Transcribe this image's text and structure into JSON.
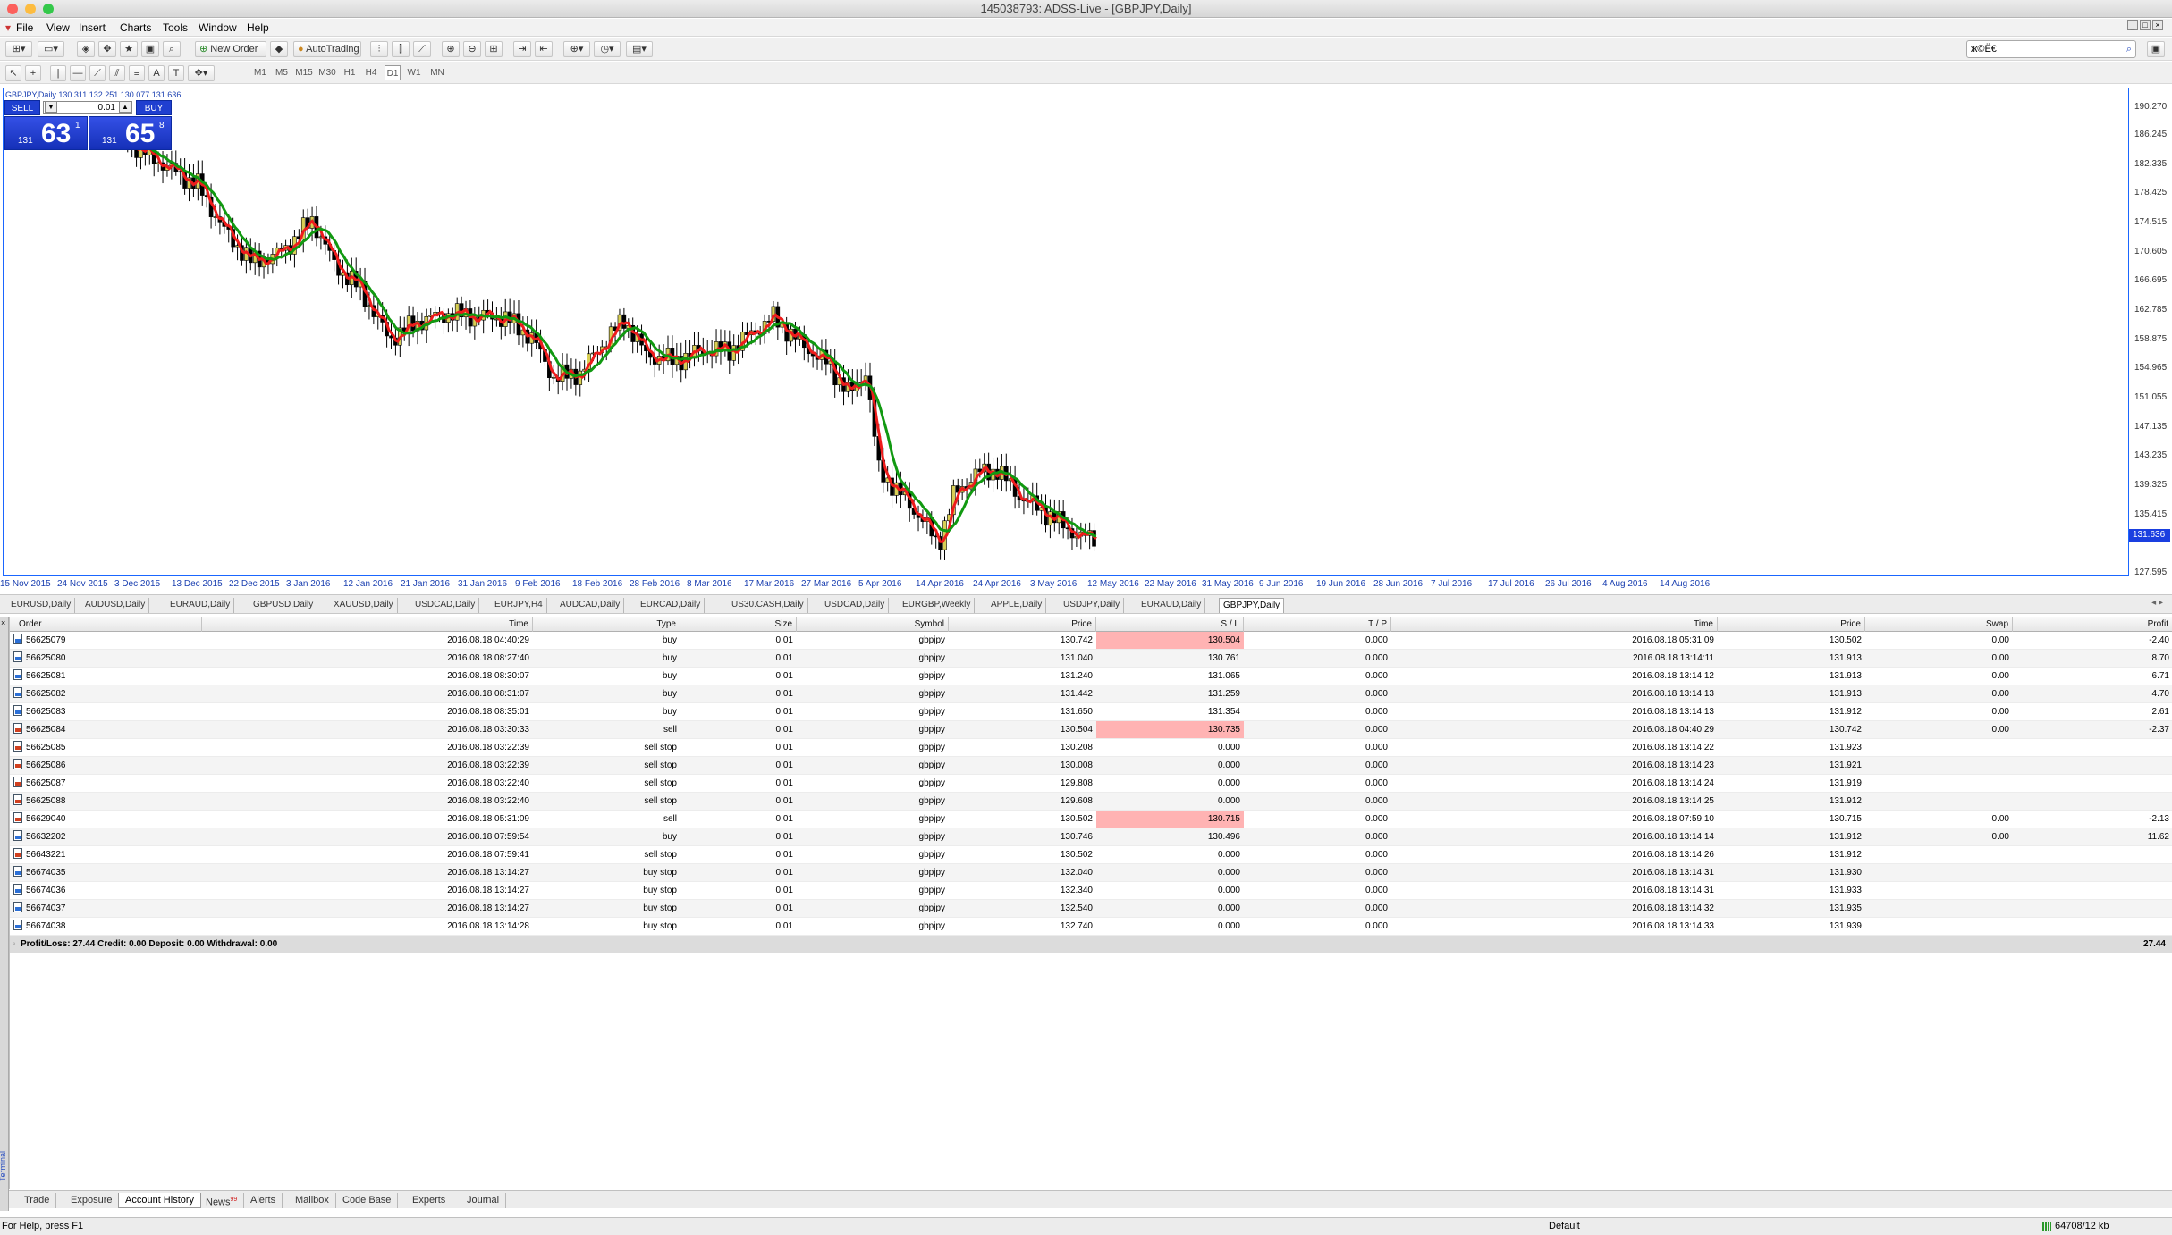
{
  "window": {
    "title": "145038793: ADSS-Live - [GBPJPY,Daily]"
  },
  "menu": [
    "File",
    "View",
    "Insert",
    "Charts",
    "Tools",
    "Window",
    "Help"
  ],
  "toolbar": {
    "new_order": "New Order",
    "autotrading": "AutoTrading",
    "search_value": "ж©Ё€",
    "timeframes": [
      "M1",
      "M5",
      "M15",
      "M30",
      "H1",
      "H4",
      "D1",
      "W1",
      "MN"
    ]
  },
  "chart": {
    "label": "GBPJPY,Daily  130.311 132.251 130.077 131.636",
    "one_click": {
      "sell_label": "SELL",
      "buy_label": "BUY",
      "lot": "0.01",
      "sell_small": "131",
      "sell_big": "63",
      "sell_sup": "1",
      "buy_small": "131",
      "buy_big": "65",
      "buy_sup": "8"
    },
    "current_price": "131.636",
    "price_ticks": [
      "190.270",
      "186.245",
      "182.335",
      "178.425",
      "174.515",
      "170.605",
      "166.695",
      "162.785",
      "158.875",
      "154.965",
      "151.055",
      "147.135",
      "143.235",
      "139.325",
      "135.415",
      "127.595"
    ],
    "date_ticks": [
      "15 Nov 2015",
      "24 Nov 2015",
      "3 Dec 2015",
      "13 Dec 2015",
      "22 Dec 2015",
      "3 Jan 2016",
      "12 Jan 2016",
      "21 Jan 2016",
      "31 Jan 2016",
      "9 Feb 2016",
      "18 Feb 2016",
      "28 Feb 2016",
      "8 Mar 2016",
      "17 Mar 2016",
      "27 Mar 2016",
      "5 Apr 2016",
      "14 Apr 2016",
      "24 Apr 2016",
      "3 May 2016",
      "12 May 2016",
      "22 May 2016",
      "31 May 2016",
      "9 Jun 2016",
      "19 Jun 2016",
      "28 Jun 2016",
      "7 Jul 2016",
      "17 Jul 2016",
      "26 Jul 2016",
      "4 Aug 2016",
      "14 Aug 2016"
    ],
    "colors": {
      "fast_ma": "#ee1c1c",
      "slow_ma": "#119911",
      "bull": "#d8cf55",
      "bear": "#000000"
    }
  },
  "chart_data": {
    "type": "candlestick",
    "symbol": "GBPJPY",
    "timeframe": "Daily",
    "ylim": [
      127.595,
      190.27
    ],
    "last": {
      "open": 130.311,
      "high": 132.251,
      "low": 130.077,
      "close": 131.636
    }
  },
  "chart_tabs": [
    "EURUSD,Daily",
    "AUDUSD,Daily",
    "EURAUD,Daily",
    "GBPUSD,Daily",
    "XAUUSD,Daily",
    "USDCAD,Daily",
    "EURJPY,H4",
    "AUDCAD,Daily",
    "EURCAD,Daily",
    "US30.CASH,Daily",
    "USDCAD,Daily",
    "EURGBP,Weekly",
    "APPLE,Daily",
    "USDJPY,Daily",
    "EURAUD,Daily",
    "GBPJPY,Daily"
  ],
  "terminal": {
    "headers": [
      "Order",
      "Time",
      "Type",
      "Size",
      "Symbol",
      "Price",
      "S / L",
      "T / P",
      "Time",
      "Price",
      "Swap",
      "Profit"
    ],
    "rows": [
      {
        "order": "56625079",
        "time": "2016.08.18 04:40:29",
        "type": "buy",
        "size": "0.01",
        "symbol": "gbpjpy",
        "price": "130.742",
        "sl": "130.504",
        "tp": "0.000",
        "ctime": "2016.08.18 05:31:09",
        "cprice": "130.502",
        "swap": "0.00",
        "profit": "-2.40",
        "hit": true
      },
      {
        "order": "56625080",
        "time": "2016.08.18 08:27:40",
        "type": "buy",
        "size": "0.01",
        "symbol": "gbpjpy",
        "price": "131.040",
        "sl": "130.761",
        "tp": "0.000",
        "ctime": "2016.08.18 13:14:11",
        "cprice": "131.913",
        "swap": "0.00",
        "profit": "8.70",
        "hit": false
      },
      {
        "order": "56625081",
        "time": "2016.08.18 08:30:07",
        "type": "buy",
        "size": "0.01",
        "symbol": "gbpjpy",
        "price": "131.240",
        "sl": "131.065",
        "tp": "0.000",
        "ctime": "2016.08.18 13:14:12",
        "cprice": "131.913",
        "swap": "0.00",
        "profit": "6.71",
        "hit": false
      },
      {
        "order": "56625082",
        "time": "2016.08.18 08:31:07",
        "type": "buy",
        "size": "0.01",
        "symbol": "gbpjpy",
        "price": "131.442",
        "sl": "131.259",
        "tp": "0.000",
        "ctime": "2016.08.18 13:14:13",
        "cprice": "131.913",
        "swap": "0.00",
        "profit": "4.70",
        "hit": false
      },
      {
        "order": "56625083",
        "time": "2016.08.18 08:35:01",
        "type": "buy",
        "size": "0.01",
        "symbol": "gbpjpy",
        "price": "131.650",
        "sl": "131.354",
        "tp": "0.000",
        "ctime": "2016.08.18 13:14:13",
        "cprice": "131.912",
        "swap": "0.00",
        "profit": "2.61",
        "hit": false
      },
      {
        "order": "56625084",
        "time": "2016.08.18 03:30:33",
        "type": "sell",
        "size": "0.01",
        "symbol": "gbpjpy",
        "price": "130.504",
        "sl": "130.735",
        "tp": "0.000",
        "ctime": "2016.08.18 04:40:29",
        "cprice": "130.742",
        "swap": "0.00",
        "profit": "-2.37",
        "hit": true
      },
      {
        "order": "56625085",
        "time": "2016.08.18 03:22:39",
        "type": "sell stop",
        "size": "0.01",
        "symbol": "gbpjpy",
        "price": "130.208",
        "sl": "0.000",
        "tp": "0.000",
        "ctime": "2016.08.18 13:14:22",
        "cprice": "131.923",
        "swap": "",
        "profit": "",
        "hit": false
      },
      {
        "order": "56625086",
        "time": "2016.08.18 03:22:39",
        "type": "sell stop",
        "size": "0.01",
        "symbol": "gbpjpy",
        "price": "130.008",
        "sl": "0.000",
        "tp": "0.000",
        "ctime": "2016.08.18 13:14:23",
        "cprice": "131.921",
        "swap": "",
        "profit": "",
        "hit": false
      },
      {
        "order": "56625087",
        "time": "2016.08.18 03:22:40",
        "type": "sell stop",
        "size": "0.01",
        "symbol": "gbpjpy",
        "price": "129.808",
        "sl": "0.000",
        "tp": "0.000",
        "ctime": "2016.08.18 13:14:24",
        "cprice": "131.919",
        "swap": "",
        "profit": "",
        "hit": false
      },
      {
        "order": "56625088",
        "time": "2016.08.18 03:22:40",
        "type": "sell stop",
        "size": "0.01",
        "symbol": "gbpjpy",
        "price": "129.608",
        "sl": "0.000",
        "tp": "0.000",
        "ctime": "2016.08.18 13:14:25",
        "cprice": "131.912",
        "swap": "",
        "profit": "",
        "hit": false
      },
      {
        "order": "56629040",
        "time": "2016.08.18 05:31:09",
        "type": "sell",
        "size": "0.01",
        "symbol": "gbpjpy",
        "price": "130.502",
        "sl": "130.715",
        "tp": "0.000",
        "ctime": "2016.08.18 07:59:10",
        "cprice": "130.715",
        "swap": "0.00",
        "profit": "-2.13",
        "hit": true
      },
      {
        "order": "56632202",
        "time": "2016.08.18 07:59:54",
        "type": "buy",
        "size": "0.01",
        "symbol": "gbpjpy",
        "price": "130.746",
        "sl": "130.496",
        "tp": "0.000",
        "ctime": "2016.08.18 13:14:14",
        "cprice": "131.912",
        "swap": "0.00",
        "profit": "11.62",
        "hit": false
      },
      {
        "order": "56643221",
        "time": "2016.08.18 07:59:41",
        "type": "sell stop",
        "size": "0.01",
        "symbol": "gbpjpy",
        "price": "130.502",
        "sl": "0.000",
        "tp": "0.000",
        "ctime": "2016.08.18 13:14:26",
        "cprice": "131.912",
        "swap": "",
        "profit": "",
        "hit": false
      },
      {
        "order": "56674035",
        "time": "2016.08.18 13:14:27",
        "type": "buy stop",
        "size": "0.01",
        "symbol": "gbpjpy",
        "price": "132.040",
        "sl": "0.000",
        "tp": "0.000",
        "ctime": "2016.08.18 13:14:31",
        "cprice": "131.930",
        "swap": "",
        "profit": "",
        "hit": false
      },
      {
        "order": "56674036",
        "time": "2016.08.18 13:14:27",
        "type": "buy stop",
        "size": "0.01",
        "symbol": "gbpjpy",
        "price": "132.340",
        "sl": "0.000",
        "tp": "0.000",
        "ctime": "2016.08.18 13:14:31",
        "cprice": "131.933",
        "swap": "",
        "profit": "",
        "hit": false
      },
      {
        "order": "56674037",
        "time": "2016.08.18 13:14:27",
        "type": "buy stop",
        "size": "0.01",
        "symbol": "gbpjpy",
        "price": "132.540",
        "sl": "0.000",
        "tp": "0.000",
        "ctime": "2016.08.18 13:14:32",
        "cprice": "131.935",
        "swap": "",
        "profit": "",
        "hit": false
      },
      {
        "order": "56674038",
        "time": "2016.08.18 13:14:28",
        "type": "buy stop",
        "size": "0.01",
        "symbol": "gbpjpy",
        "price": "132.740",
        "sl": "0.000",
        "tp": "0.000",
        "ctime": "2016.08.18 13:14:33",
        "cprice": "131.939",
        "swap": "",
        "profit": "",
        "hit": false
      }
    ],
    "summary": "Profit/Loss: 27.44  Credit: 0.00  Deposit: 0.00  Withdrawal: 0.00",
    "summary_total": "27.44",
    "side_label": "Terminal"
  },
  "bottom_tabs": [
    {
      "label": "Trade"
    },
    {
      "label": "Exposure"
    },
    {
      "label": "Account History",
      "active": true
    },
    {
      "label": "News",
      "badge": "99"
    },
    {
      "label": "Alerts"
    },
    {
      "label": "Mailbox"
    },
    {
      "label": "Code Base"
    },
    {
      "label": "Experts"
    },
    {
      "label": "Journal"
    }
  ],
  "status": {
    "help": "For Help, press F1",
    "profile": "Default",
    "traffic": "64708/12 kb"
  }
}
